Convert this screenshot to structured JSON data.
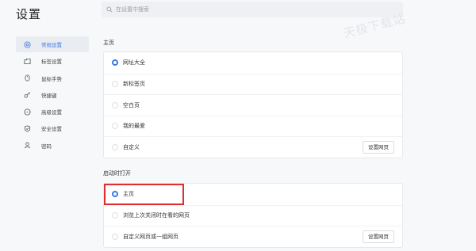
{
  "header": {
    "title": "设置",
    "search_placeholder": "在设置中搜索",
    "watermark": "天极下载站"
  },
  "sidebar": {
    "items": [
      {
        "label": "常规设置",
        "icon": "settings-circle-icon",
        "active": true
      },
      {
        "label": "标签设置",
        "icon": "tab-icon",
        "active": false
      },
      {
        "label": "鼠标手势",
        "icon": "mouse-icon",
        "active": false
      },
      {
        "label": "快捷键",
        "icon": "key-icon",
        "active": false
      },
      {
        "label": "高级设置",
        "icon": "more-circle-icon",
        "active": false
      },
      {
        "label": "安全设置",
        "icon": "shield-check-icon",
        "active": false
      },
      {
        "label": "密码",
        "icon": "user-icon",
        "active": false
      }
    ]
  },
  "homepage": {
    "title": "主页",
    "options": [
      {
        "label": "网址大全",
        "selected": true
      },
      {
        "label": "新标签页",
        "selected": false
      },
      {
        "label": "空白页",
        "selected": false
      },
      {
        "label": "我的最爱",
        "selected": false
      },
      {
        "label": "自定义",
        "selected": false,
        "button": "设置网页"
      }
    ]
  },
  "startup": {
    "title": "启动时打开",
    "options": [
      {
        "label": "主页",
        "selected": true
      },
      {
        "label": "浏览上次关闭时在看的网页",
        "selected": false
      },
      {
        "label": "自定义网页或一组网页",
        "selected": false,
        "button": "设置网页"
      }
    ]
  },
  "colors": {
    "accent": "#3a78e7",
    "highlight_border": "#e02d2d",
    "background": "#f7f8fa",
    "card": "#ffffff"
  }
}
